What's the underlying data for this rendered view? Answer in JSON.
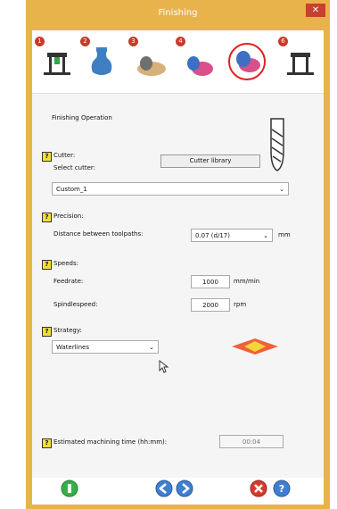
{
  "window": {
    "title": "Finishing",
    "close_label": "✕"
  },
  "steps": [
    {
      "number": "1",
      "icon": "machine-icon"
    },
    {
      "number": "2",
      "icon": "vase-icon"
    },
    {
      "number": "3",
      "icon": "roughing-icon"
    },
    {
      "number": "4",
      "icon": "semi-finish-icon"
    },
    {
      "number": "5",
      "icon": "finishing-icon"
    },
    {
      "number": "6",
      "icon": "machine-output-icon"
    }
  ],
  "form": {
    "heading": "Finishing Operation",
    "cutter": {
      "help": "?",
      "label": "Cutter:",
      "select_label": "Select cutter:",
      "library_button": "Cutter library",
      "value": "Custom_1"
    },
    "precision": {
      "help": "?",
      "label": "Precision:",
      "distance_label": "Distance between toolpaths:",
      "distance_value": "0.07  (d/17)",
      "unit": "mm"
    },
    "speeds": {
      "help": "?",
      "label": "Speeds:",
      "feedrate_label": "Feedrate:",
      "feedrate_value": "1000",
      "feedrate_unit": "mm/min",
      "spindle_label": "Spindlespeed:",
      "spindle_value": "2000",
      "spindle_unit": "rpm"
    },
    "strategy": {
      "help": "?",
      "label": "Strategy:",
      "value": "Waterlines"
    },
    "time": {
      "help": "?",
      "label": "Estimated machining time (hh:mm):",
      "value": "00:04"
    }
  },
  "footer": {
    "start_icon": "start-icon",
    "back_icon": "back-icon",
    "next_icon": "next-icon",
    "cancel_icon": "cancel-icon",
    "help_icon": "help-icon"
  },
  "colors": {
    "title_bar": "#e9b34b",
    "close": "#c84030",
    "accent_ring": "#e02020",
    "help_yellow": "#f2de3a"
  }
}
